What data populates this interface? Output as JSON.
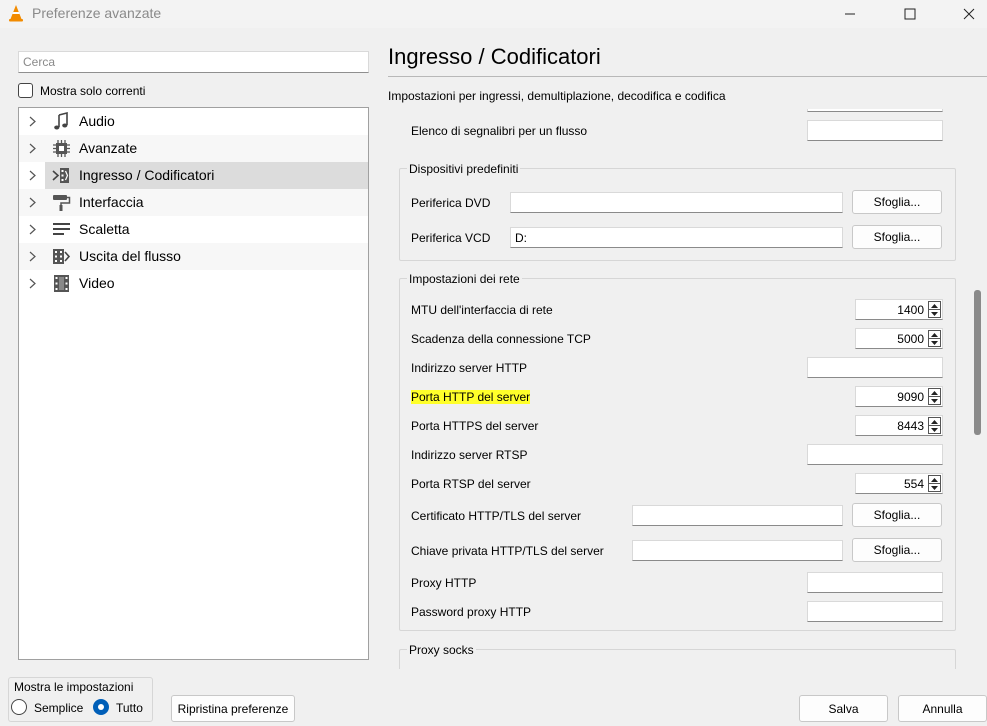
{
  "window": {
    "title": "Preferenze avanzate",
    "controls": [
      "minimize-icon",
      "maximize-icon",
      "close-icon"
    ]
  },
  "left": {
    "search_placeholder": "Cerca",
    "only_current_label": "Mostra solo correnti",
    "only_current_checked": false,
    "tree": [
      {
        "label": "Audio",
        "icon": "music-note-icon"
      },
      {
        "label": "Avanzate",
        "icon": "chip-icon"
      },
      {
        "label": "Ingresso / Codificatori",
        "icon": "input-codec-icon",
        "selected": true
      },
      {
        "label": "Interfaccia",
        "icon": "paint-roller-icon"
      },
      {
        "label": "Scaletta",
        "icon": "playlist-icon"
      },
      {
        "label": "Uscita del flusso",
        "icon": "stream-output-icon"
      },
      {
        "label": "Video",
        "icon": "film-icon"
      }
    ]
  },
  "right": {
    "title": "Ingresso / Codificatori",
    "description": "Impostazioni per ingressi, demultiplazione, decodifica e codifica",
    "bookmarks_label": "Elenco di segnalibri per un flusso",
    "bookmarks_value": "",
    "devices": {
      "title": "Dispositivi predefiniti",
      "dvd_label": "Periferica DVD",
      "dvd_value": "",
      "vcd_label": "Periferica VCD",
      "vcd_value": "D:",
      "browse": "Sfoglia..."
    },
    "network": {
      "title": "Impostazioni dei rete",
      "mtu_label": "MTU dell'interfaccia di rete",
      "mtu_value": "1400",
      "tcp_label": "Scadenza della connessione TCP",
      "tcp_value": "5000",
      "http_host_label": "Indirizzo server HTTP",
      "http_host_value": "",
      "http_port_label": "Porta HTTP del server",
      "http_port_value": "9090",
      "https_port_label": "Porta HTTPS del server",
      "https_port_value": "8443",
      "rtsp_host_label": "Indirizzo server RTSP",
      "rtsp_host_value": "",
      "rtsp_port_label": "Porta RTSP del server",
      "rtsp_port_value": "554",
      "cert_label": "Certificato HTTP/TLS del server",
      "cert_value": "",
      "key_label": "Chiave privata HTTP/TLS del server",
      "key_value": "",
      "proxy_label": "Proxy HTTP",
      "proxy_value": "",
      "proxy_pwd_label": "Password proxy HTTP",
      "proxy_pwd_value": ""
    },
    "socks": {
      "title": "Proxy socks"
    },
    "highlight_color": "#ffff2a"
  },
  "bottom": {
    "show_title": "Mostra le impostazioni",
    "simple_label": "Semplice",
    "all_label": "Tutto",
    "selected": "Tutto",
    "reset_label": "Ripristina preferenze",
    "save_label": "Salva",
    "cancel_label": "Annulla"
  },
  "colors": {
    "accent": "#005fb8",
    "selection": "#dcdcdc",
    "vlc_orange": "#f28b00"
  }
}
